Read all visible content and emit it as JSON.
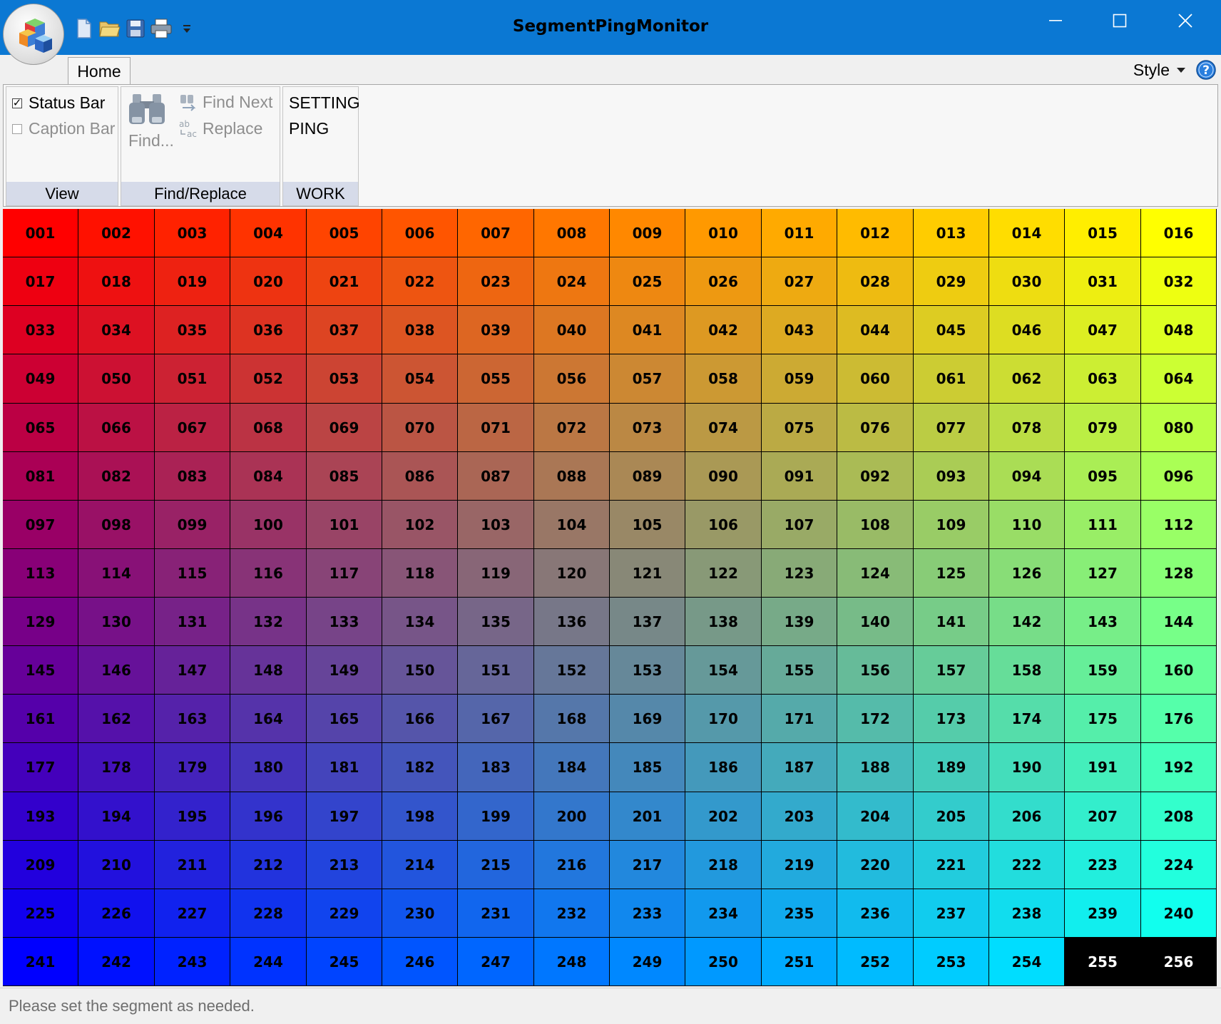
{
  "window": {
    "title": "SegmentPingMonitor",
    "accent": "#0b78d3"
  },
  "qat": [
    "new-icon",
    "open-icon",
    "save-icon",
    "print-icon",
    "customize-dropdown-icon"
  ],
  "tabs": {
    "home": "Home"
  },
  "style_menu": {
    "label": "Style"
  },
  "ribbon": {
    "view": {
      "label": "View",
      "status_bar": {
        "label": "Status Bar",
        "checked": true
      },
      "caption_bar": {
        "label": "Caption Bar",
        "checked": false
      }
    },
    "find_replace": {
      "label": "Find/Replace",
      "find": "Find...",
      "find_next": "Find Next",
      "replace": "Replace"
    },
    "work": {
      "label": "WORK",
      "setting": "SETTING",
      "ping": "PING"
    }
  },
  "grid": {
    "rows": 16,
    "cols": 16,
    "labels": [
      "001",
      "002",
      "003",
      "004",
      "005",
      "006",
      "007",
      "008",
      "009",
      "010",
      "011",
      "012",
      "013",
      "014",
      "015",
      "016",
      "017",
      "018",
      "019",
      "020",
      "021",
      "022",
      "023",
      "024",
      "025",
      "026",
      "027",
      "028",
      "029",
      "030",
      "031",
      "032",
      "033",
      "034",
      "035",
      "036",
      "037",
      "038",
      "039",
      "040",
      "041",
      "042",
      "043",
      "044",
      "045",
      "046",
      "047",
      "048",
      "049",
      "050",
      "051",
      "052",
      "053",
      "054",
      "055",
      "056",
      "057",
      "058",
      "059",
      "060",
      "061",
      "062",
      "063",
      "064",
      "065",
      "066",
      "067",
      "068",
      "069",
      "070",
      "071",
      "072",
      "073",
      "074",
      "075",
      "076",
      "077",
      "078",
      "079",
      "080",
      "081",
      "082",
      "083",
      "084",
      "085",
      "086",
      "087",
      "088",
      "089",
      "090",
      "091",
      "092",
      "093",
      "094",
      "095",
      "096",
      "097",
      "098",
      "099",
      "100",
      "101",
      "102",
      "103",
      "104",
      "105",
      "106",
      "107",
      "108",
      "109",
      "110",
      "111",
      "112",
      "113",
      "114",
      "115",
      "116",
      "117",
      "118",
      "119",
      "120",
      "121",
      "122",
      "123",
      "124",
      "125",
      "126",
      "127",
      "128",
      "129",
      "130",
      "131",
      "132",
      "133",
      "134",
      "135",
      "136",
      "137",
      "138",
      "139",
      "140",
      "141",
      "142",
      "143",
      "144",
      "145",
      "146",
      "147",
      "148",
      "149",
      "150",
      "151",
      "152",
      "153",
      "154",
      "155",
      "156",
      "157",
      "158",
      "159",
      "160",
      "161",
      "162",
      "163",
      "164",
      "165",
      "166",
      "167",
      "168",
      "169",
      "170",
      "171",
      "172",
      "173",
      "174",
      "175",
      "176",
      "177",
      "178",
      "179",
      "180",
      "181",
      "182",
      "183",
      "184",
      "185",
      "186",
      "187",
      "188",
      "189",
      "190",
      "191",
      "192",
      "193",
      "194",
      "195",
      "196",
      "197",
      "198",
      "199",
      "200",
      "201",
      "202",
      "203",
      "204",
      "205",
      "206",
      "207",
      "208",
      "209",
      "210",
      "211",
      "212",
      "213",
      "214",
      "215",
      "216",
      "217",
      "218",
      "219",
      "220",
      "221",
      "222",
      "223",
      "224",
      "225",
      "226",
      "227",
      "228",
      "229",
      "230",
      "231",
      "232",
      "233",
      "234",
      "235",
      "236",
      "237",
      "238",
      "239",
      "240",
      "241",
      "242",
      "243",
      "244",
      "245",
      "246",
      "247",
      "248",
      "249",
      "250",
      "251",
      "252",
      "253",
      "254",
      "255",
      "256"
    ],
    "corner_colors": {
      "top_left": "#ff0000",
      "top_right": "#ffff00",
      "bottom_left": "#0000ff",
      "bottom_right": "#00ffff"
    },
    "highlighted": [
      {
        "label": "255",
        "bg": "#000000",
        "fg": "#ffffff"
      },
      {
        "label": "256",
        "bg": "#000000",
        "fg": "#ffffff"
      }
    ]
  },
  "status": {
    "text": "Please set the segment as needed."
  }
}
